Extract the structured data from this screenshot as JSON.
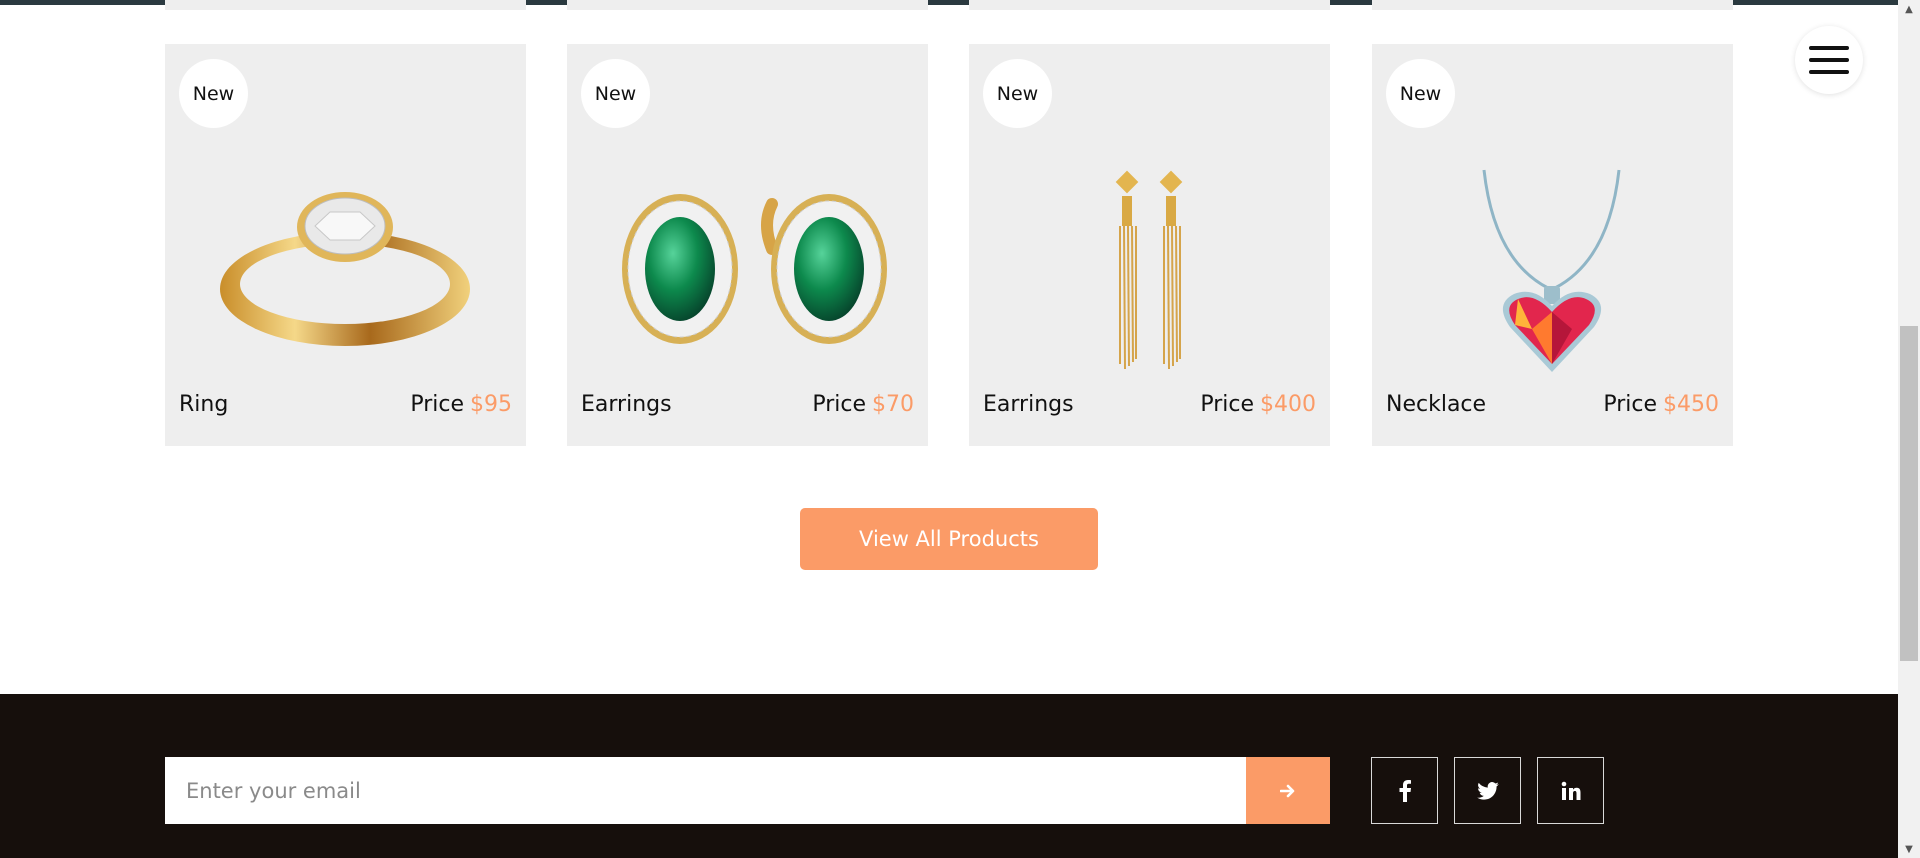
{
  "products": [
    {
      "badge": "New",
      "name": "Ring",
      "price_label": "Price",
      "price": "$95",
      "image_icon": "ring-icon"
    },
    {
      "badge": "New",
      "name": "Earrings",
      "price_label": "Price",
      "price": "$70",
      "image_icon": "emerald-earrings-icon"
    },
    {
      "badge": "New",
      "name": "Earrings",
      "price_label": "Price",
      "price": "$400",
      "image_icon": "tassel-earrings-icon"
    },
    {
      "badge": "New",
      "name": "Necklace",
      "price_label": "Price",
      "price": "$450",
      "image_icon": "heart-necklace-icon"
    }
  ],
  "view_all_label": "View All Products",
  "newsletter": {
    "placeholder": "Enter your email",
    "submit_icon": "arrow-right-icon"
  },
  "social": [
    {
      "icon": "facebook-icon",
      "glyph": "f"
    },
    {
      "icon": "twitter-icon",
      "glyph": "🐦"
    },
    {
      "icon": "linkedin-icon",
      "glyph": "in"
    }
  ],
  "colors": {
    "accent": "#fb9b67",
    "card_bg": "#eeeeee",
    "footer_bg": "#160f0c"
  }
}
